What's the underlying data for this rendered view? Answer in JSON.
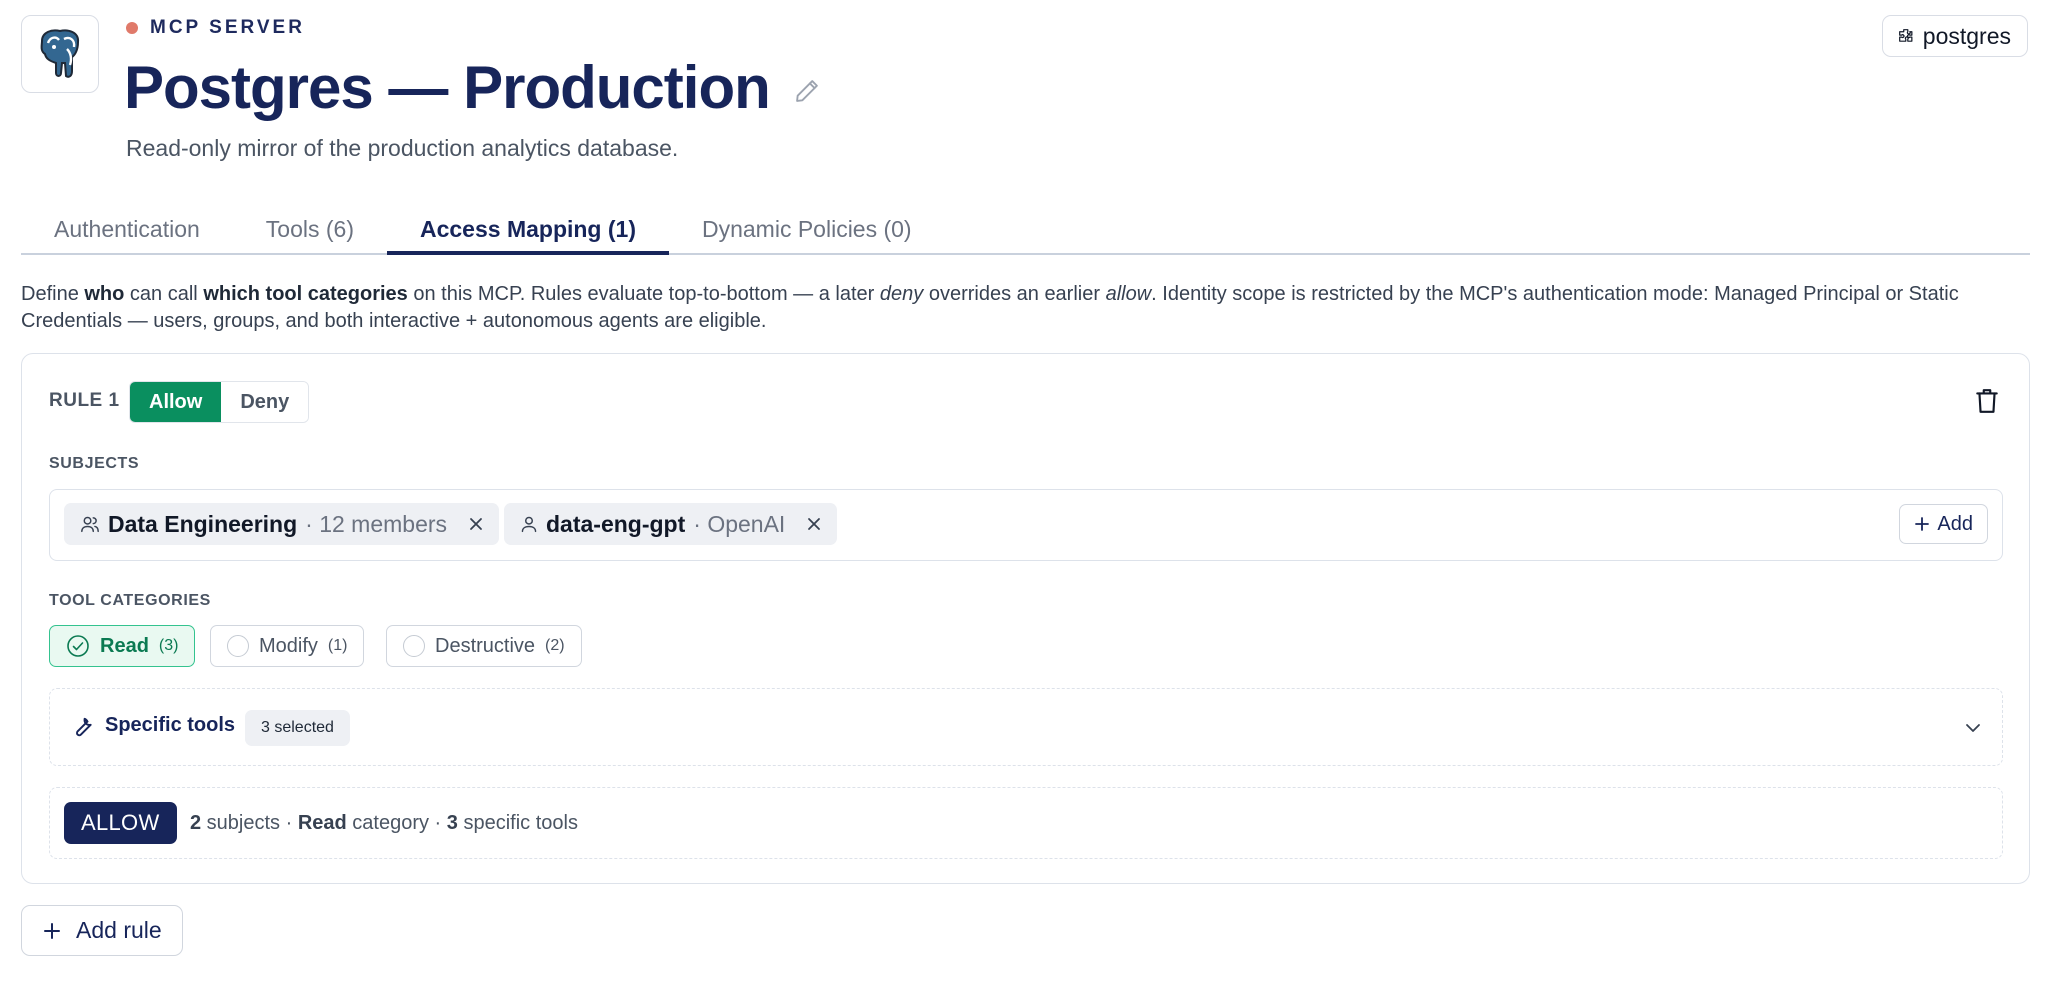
{
  "header": {
    "eyebrow": "MCP SERVER",
    "title": "Postgres — Production",
    "subtitle": "Read-only mirror of the production analytics database.",
    "connector_label": "postgres",
    "status_color": "#e07a6a",
    "logo_icon": "postgres-elephant-icon"
  },
  "tabs": [
    {
      "label": "Authentication",
      "active": false
    },
    {
      "label": "Tools (6)",
      "active": false
    },
    {
      "label": "Access Mapping (1)",
      "active": true
    },
    {
      "label": "Dynamic Policies (0)",
      "active": false
    }
  ],
  "description": {
    "p1": "Define ",
    "who": "who",
    "p2": " can call ",
    "which": "which tool categories",
    "p3": " on this MCP. Rules evaluate top-to-bottom — a later ",
    "deny": "deny",
    "p4": " overrides an earlier ",
    "allow": "allow",
    "p5": ". Identity scope is restricted by the MCP's authentication mode: Managed Principal or Static Credentials — users, groups, and both interactive + autonomous agents are eligible."
  },
  "rule": {
    "label": "RULE 1",
    "effect_options": [
      "Allow",
      "Deny"
    ],
    "selected_effect": "Allow",
    "subjects_label": "SUBJECTS",
    "subjects": [
      {
        "name": "Data Engineering",
        "meta": "· 12 members",
        "icon": "group-icon"
      },
      {
        "name": "data-eng-gpt",
        "meta": "· OpenAI",
        "icon": "user-icon"
      }
    ],
    "add_label": "Add",
    "tool_categories_label": "TOOL CATEGORIES",
    "categories": [
      {
        "name": "Read",
        "count": "(3)",
        "selected": true
      },
      {
        "name": "Modify",
        "count": "(1)",
        "selected": false
      },
      {
        "name": "Destructive",
        "count": "(2)",
        "selected": false
      }
    ],
    "specific_tools_label": "Specific tools",
    "specific_tools_badge": "3 selected",
    "summary": {
      "tag": "ALLOW",
      "subjects_count": "2",
      "subjects_word": " subjects · ",
      "category": "Read",
      "category_word": " category · ",
      "tools_count": "3",
      "tools_word": " specific tools"
    }
  },
  "add_rule_label": "Add rule",
  "colors": {
    "primary": "#17255a",
    "allow_green": "#0a8f5f",
    "selected_bg": "#e9f9f1"
  }
}
